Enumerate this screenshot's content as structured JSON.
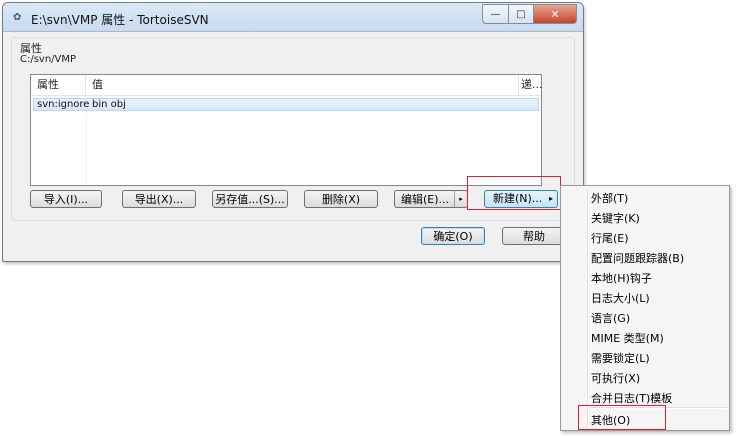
{
  "window": {
    "title": "E:\\svn\\VMP  属性 - TortoiseSVN",
    "minimize_glyph": "—",
    "maximize_glyph": "□",
    "close_glyph": "✕"
  },
  "group": {
    "label": "属性",
    "path": "C:/svn/VMP"
  },
  "listview": {
    "columns": [
      "属性",
      "值",
      "递..."
    ],
    "rows": [
      {
        "property": "svn:ignore",
        "value": "bin obj"
      }
    ]
  },
  "buttons": {
    "import": "导入(I)...",
    "export": "导出(X)...",
    "save_value": "另存值...(S)...",
    "delete": "删除(X)",
    "edit": "编辑(E)...",
    "edit_arrow": "▸",
    "new": "新建(N)...",
    "new_arrow": "▸",
    "ok": "确定(O)",
    "help": "帮助"
  },
  "menu": {
    "items": [
      "外部(T)",
      "关键字(K)",
      "行尾(E)",
      "配置问题跟踪器(B)",
      "本地(H)钩子",
      "日志大小(L)",
      "语言(G)",
      "MIME 类型(M)",
      "需要锁定(L)",
      "可执行(X)",
      "合并日志(T)模板",
      "其他(O)"
    ]
  }
}
